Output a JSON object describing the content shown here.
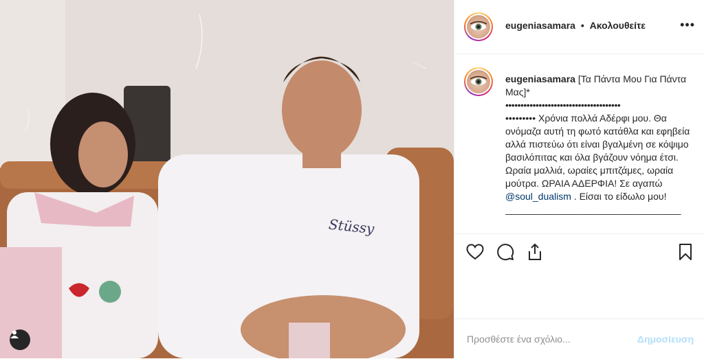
{
  "post": {
    "username": "eugeniasamara",
    "separator": "•",
    "follow_label": "Ακολουθείτε",
    "more_label": "•••"
  },
  "caption": {
    "username": "eugeniasamara",
    "line1": "[Τα Πάντα Μου Για Πάντα Μας]*",
    "dots_row1": "••••••••••••••••••••••••••••••••••••••",
    "dots_row2_and_text": "••••••••• Χρόνια πολλά Αδέρφι μου. Θα ονόμαζα αυτή τη φωτό κατάθλα και εφηβεία αλλά πιστεύω ότι είναι βγαλμένη σε κόψιμο βασιλόπιτας και όλα βγάζουν νόημα έτσι. Ωραία μαλλιά, ωραίες μπιτζάμες, ωραία μούτρα. ΩΡΑΙΑ ΑΔΕΡΦΙΑ! Σε αγαπώ",
    "mention": "@soul_dualism",
    "after_mention": " . Είσαι το είδωλο μου!",
    "underline": "___________________________________"
  },
  "photo": {
    "shirt_logo_text": "Stüssy"
  },
  "actions": {
    "icons": [
      "heart-icon",
      "comment-icon",
      "share-icon",
      "bookmark-icon"
    ]
  },
  "add_comment": {
    "placeholder": "Προσθέστε ένα σχόλιο...",
    "publish_label": "Δημοσίευση"
  },
  "colors": {
    "link": "#00376b",
    "publish_disabled": "#b2dffc",
    "muted": "#8e8e8e"
  }
}
